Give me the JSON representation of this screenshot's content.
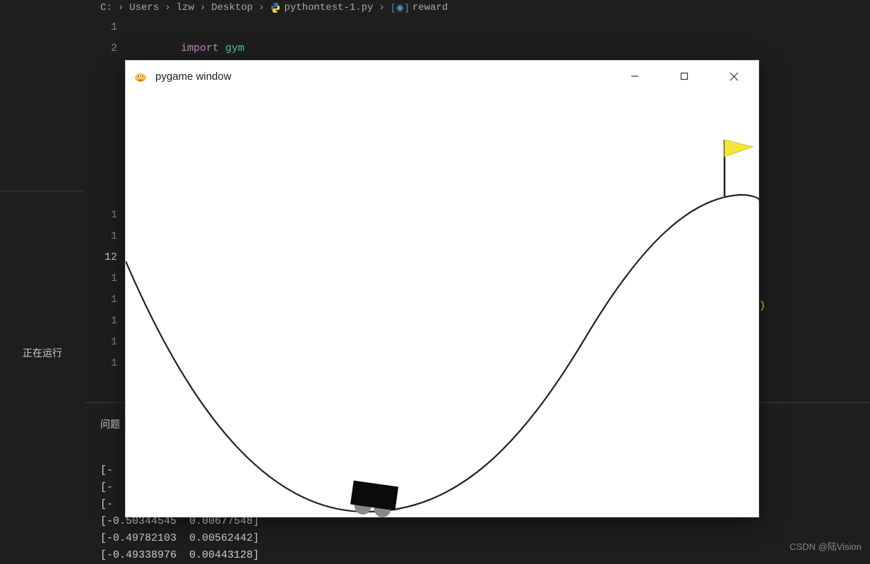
{
  "breadcrumb": {
    "seg1": "C:",
    "seg2": "Users",
    "seg3": "lzw",
    "seg4": "Desktop",
    "seg5": "pythontest-1.py",
    "seg6": "reward"
  },
  "editor": {
    "lines": {
      "l1": "1",
      "l2": "2",
      "l10": "1",
      "l11": "1",
      "l12": "1",
      "l12full": "12",
      "l13": "1",
      "l14": "1",
      "l15": "1",
      "l16": "1",
      "l17": "1"
    },
    "code1_kw": "import",
    "code1_mod": " gym"
  },
  "rightsnip": {
    "id": "t",
    "p1": ")",
    "p2": ")"
  },
  "sidebar": {
    "running": "正在运行"
  },
  "panel": {
    "tabs_label": "问题",
    "out1_trunc": "[-",
    "out2_trunc": "[-",
    "out3_trunc": "[-",
    "out4": "[-0.50344545  0.00677548]",
    "out5": "[-0.49782103  0.00562442]",
    "out6": "[-0.49338976  0.00443128]"
  },
  "pygame": {
    "title": "pygame window"
  },
  "watermark": "CSDN @陆Vision"
}
